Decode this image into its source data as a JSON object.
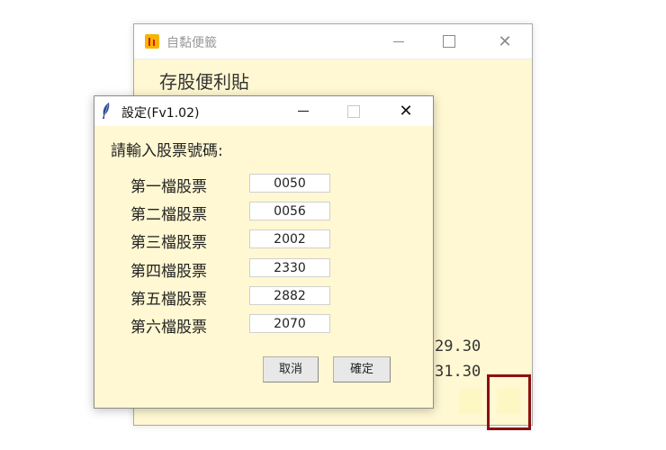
{
  "back_window": {
    "title": "自黏便籤",
    "heading": "存股便利貼",
    "prices": [
      "29.30",
      "31.30"
    ],
    "controls": {
      "minimize": "—",
      "maximize": "☐",
      "close": "✕"
    }
  },
  "dialog": {
    "title": "設定(Fv1.02)",
    "prompt": "請輸入股票號碼:",
    "rows": [
      {
        "label": "第一檔股票",
        "value": "0050"
      },
      {
        "label": "第二檔股票",
        "value": "0056"
      },
      {
        "label": "第三檔股票",
        "value": "2002"
      },
      {
        "label": "第四檔股票",
        "value": "2330"
      },
      {
        "label": "第五檔股票",
        "value": "2882"
      },
      {
        "label": "第六檔股票",
        "value": "2070"
      }
    ],
    "cancel_label": "取消",
    "ok_label": "確定"
  },
  "colors": {
    "note_background": "#fff8d2",
    "highlight_border": "#8b1010",
    "swatch": "#fdf8c3"
  },
  "icons": {
    "back_app": "bar-chart-icon",
    "dialog_app": "feather-icon"
  }
}
